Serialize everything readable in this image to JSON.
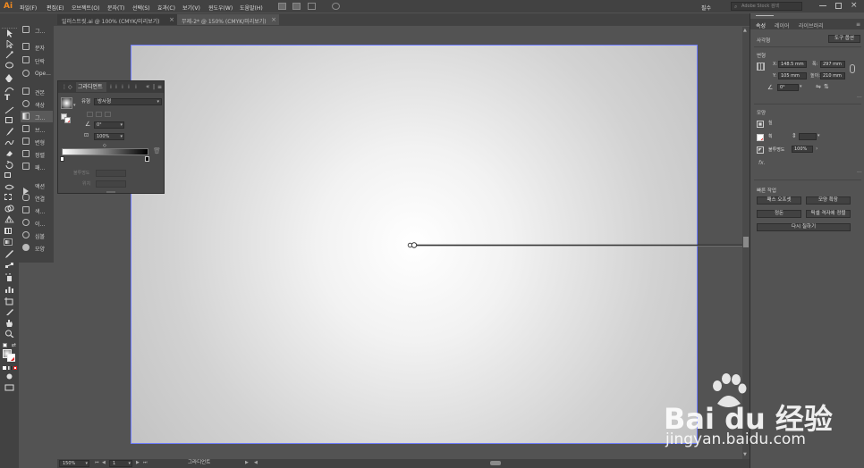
{
  "app": {
    "logo": "Ai"
  },
  "menu": [
    "파일(F)",
    "편집(E)",
    "오브젝트(O)",
    "문자(T)",
    "선택(S)",
    "효과(C)",
    "보기(V)",
    "윈도우(W)",
    "도움말(H)"
  ],
  "menubar_right": {
    "workspace": "필수",
    "search_placeholder": "Adobe Stock 검색"
  },
  "tabs": [
    {
      "label": "일러스트릿.ai @ 100% (CMYK/미리보기)",
      "active": false
    },
    {
      "label": "무제-2* @ 150% (CMYK/미리보기)",
      "active": true
    }
  ],
  "mini_panel": [
    {
      "label": "그..."
    },
    {
      "label": "문자"
    },
    {
      "label": "단락"
    },
    {
      "label": "Ope..."
    },
    {
      "label": "견본"
    },
    {
      "label": "색상"
    },
    {
      "label": "그..."
    },
    {
      "label": "브..."
    },
    {
      "label": "변형"
    },
    {
      "label": "정렬"
    },
    {
      "label": "패..."
    },
    {
      "label": "액션"
    },
    {
      "label": "연결"
    },
    {
      "label": "색..."
    },
    {
      "label": "이..."
    },
    {
      "label": "심볼"
    },
    {
      "label": "모양"
    }
  ],
  "gradient_panel": {
    "title": "그라디언트",
    "type_label": "유형",
    "type_value": "방사형",
    "angle_value": "0°",
    "ratio_value": "100%",
    "opacity_label": "불투명도",
    "location_label": "위치"
  },
  "right_panel": {
    "tabs": [
      "속성",
      "레이어",
      "라이브러리"
    ],
    "section_rect": "사각형",
    "tool_option_button": "도구 옵션",
    "section_transform": "변형",
    "x_label": "X:",
    "x_value": "148.5 mm",
    "y_label": "Y:",
    "y_value": "105 mm",
    "w_label": "폭:",
    "w_value": "297 mm",
    "h_label": "높이:",
    "h_value": "210 mm",
    "rotate_value": "0°",
    "section_appearance": "모양",
    "fill_label": "칠",
    "stroke_label": "획",
    "opacity_label": "불투명도",
    "opacity_value": "100%",
    "fx_label": "fx.",
    "section_quick": "빠른 작업",
    "btn_offset_path": "패스 오프셋",
    "btn_expand": "모양 확장",
    "btn_group": "정돈",
    "btn_align": "픽셀 격자에 정렬",
    "btn_recolor": "다시 칠하기"
  },
  "status": {
    "zoom": "150%",
    "page": "1",
    "tool_name": "그라디언트"
  },
  "watermark": {
    "brand": "Bai du 经验",
    "url": "jingyan.baidu.com"
  },
  "colors": {
    "accent": "#f0891f",
    "artboard_border": "#6f7dff"
  }
}
